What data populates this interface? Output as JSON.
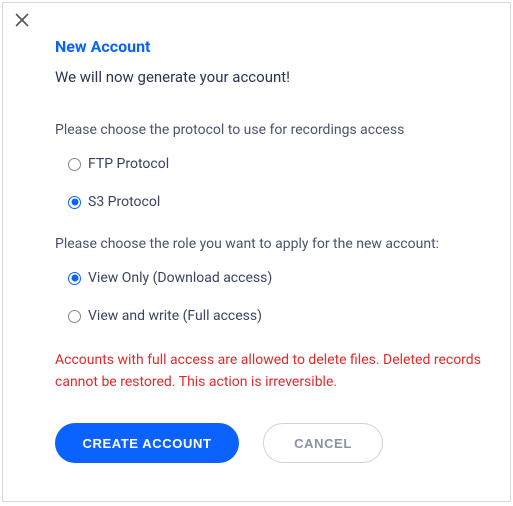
{
  "dialog": {
    "title": "New Account",
    "subtitle": "We will now generate your account!",
    "protocol": {
      "label": "Please choose the protocol to use for recordings access",
      "options": [
        {
          "label": "FTP Protocol",
          "selected": false
        },
        {
          "label": "S3 Protocol",
          "selected": true
        }
      ]
    },
    "role": {
      "label": "Please choose the role you want to apply for the new account:",
      "options": [
        {
          "label": "View Only (Download access)",
          "selected": true
        },
        {
          "label": "View and write (Full access)",
          "selected": false
        }
      ]
    },
    "warning": "Accounts with full access are allowed to delete files. Deleted records cannot be restored. This action is irreversible.",
    "buttons": {
      "primary": "CREATE ACCOUNT",
      "secondary": "CANCEL"
    }
  }
}
